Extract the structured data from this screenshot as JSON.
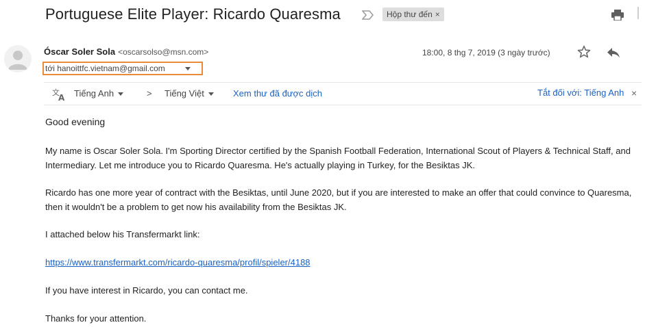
{
  "email": {
    "subject": "Portuguese Elite Player: Ricardo Quaresma",
    "label": "Hộp thư đến",
    "label_close": "×",
    "sender": {
      "name": "Óscar Soler Sola",
      "email": "<oscarsolso@msn.com>"
    },
    "date": "18:00, 8 thg 7, 2019 (3 ngày trước)",
    "recipient": "tới hanoittfc.vietnam@gmail.com"
  },
  "translation": {
    "source_language": "Tiếng Anh",
    "target_language": "Tiếng Việt",
    "arrow": ">",
    "view_translated": "Xem thư đã được dịch",
    "turn_off": "Tắt đối với: Tiếng Anh",
    "close": "×"
  },
  "body": {
    "greeting": "Good evening",
    "paragraph1": "My name is Oscar Soler Sola. I'm Sporting Director certified by the Spanish Football Federation, International Scout of Players & Technical Staff, and Intermediary. Let me introduce you to Ricardo Quaresma. He's actually playing in Turkey, for the Besiktas JK.",
    "paragraph2": "Ricardo has one more year of contract with the Besiktas, until June 2020, but if you are interested to make an offer that could convince to Quaresma, then it wouldn't be a problem to get now his availability from the Besiktas JK.",
    "paragraph3": "I attached below his Transfermarkt link:",
    "link": "https://www.transfermarkt.com/ricardo-quaresma/profil/spieler/4188",
    "paragraph4": "If you have interest in Ricardo, you can contact me.",
    "paragraph5": "Thanks for your attention."
  },
  "colors": {
    "highlight_border": "#e88a3a",
    "link": "#1a62c6",
    "chip_bg": "#dddddd"
  },
  "icons": [
    "important-marker-icon",
    "print-icon",
    "avatar-icon",
    "star-icon",
    "reply-icon",
    "translate-icon",
    "caret-down-icon"
  ]
}
